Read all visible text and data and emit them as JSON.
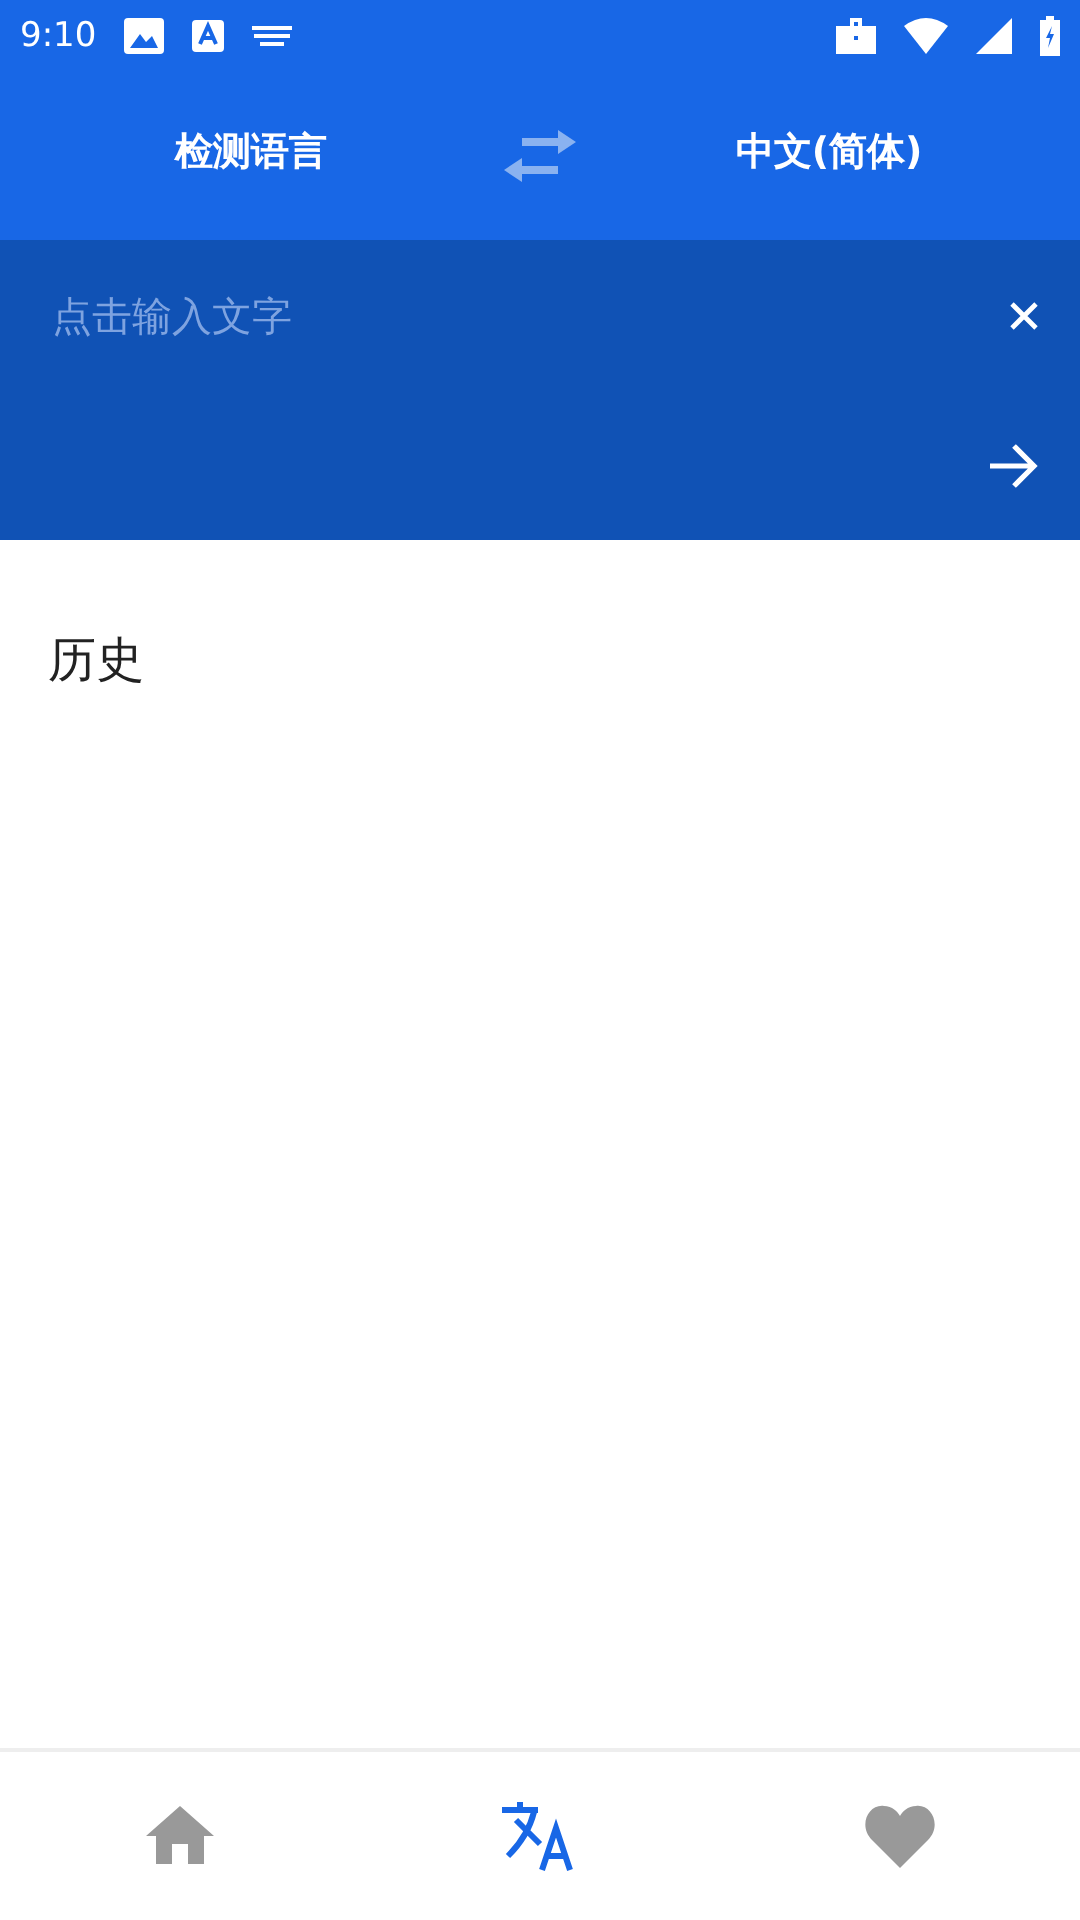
{
  "status_bar": {
    "time": "9:10"
  },
  "language_bar": {
    "source": "检测语言",
    "target": "中文(简体)"
  },
  "input": {
    "placeholder": "点击输入文字"
  },
  "history": {
    "title": "历史"
  },
  "bottom_nav": [
    {
      "kind": "home",
      "selected": false
    },
    {
      "kind": "translate",
      "selected": true
    },
    {
      "kind": "favorites",
      "selected": false
    }
  ]
}
